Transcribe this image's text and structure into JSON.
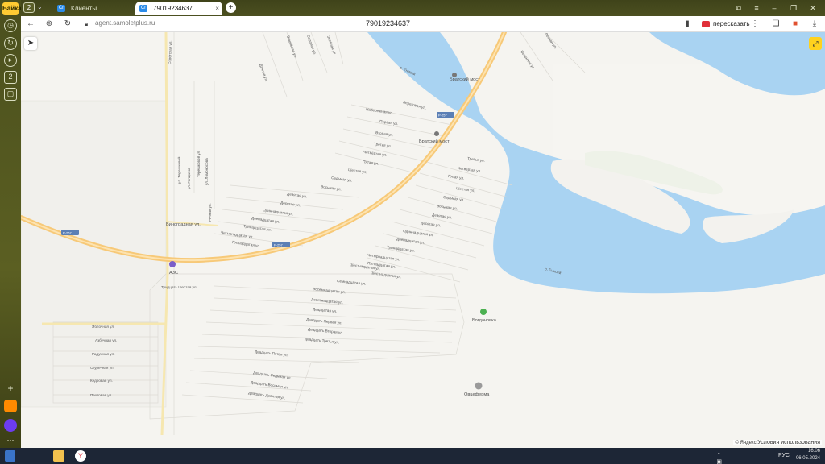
{
  "sidebar": {
    "logo_text": "Байка",
    "counter": "2"
  },
  "tabs": [
    {
      "label": "Клиенты",
      "icon": "Cr"
    },
    {
      "label": "79019234637",
      "icon": "Cr"
    }
  ],
  "tab_counter": "2",
  "address_bar": {
    "url": "agent.samoletplus.ru",
    "title": "79019234637",
    "translate_label": "пересказать"
  },
  "map": {
    "streets": [
      "Советская ул.",
      "ул. Терешковой",
      "Терешковой ул.",
      "ул. Гагарина",
      "ул. Ломоносова",
      "Речная ул.",
      "Виноградная ул.",
      "Яблочная ул.",
      "Азбучная ул.",
      "Радужная ул.",
      "Огуречная ул.",
      "Кедровая ул.",
      "Пахтовая ул.",
      "Набережная ул.",
      "Первая ул.",
      "Вторая ул.",
      "Третья ул.",
      "Четвёртая ул.",
      "Пятая ул.",
      "Шестая ул.",
      "Седьмая ул.",
      "Восьмая ул.",
      "Девятая ул.",
      "Десятая ул.",
      "Одиннадцатая ул.",
      "Двенадцатая ул.",
      "Тринадцатая ул.",
      "Четырнадцатая ул.",
      "Пятнадцатая ул.",
      "Шестнадцатая ул.",
      "Семнадцатая ул.",
      "Восемнадцатая ул.",
      "Девятнадцатая ул.",
      "Двадцатая ул.",
      "Двадцать Первая ул.",
      "Двадцать Вторая ул.",
      "Двадцать Третья ул.",
      "Двадцать Пятая ул.",
      "Двадцать Седьмая ул.",
      "Двадцать Восьмая ул.",
      "Двадцать Девятая ул.",
      "Тридцать Шестая ул.",
      "Дачная ул.",
      "Вишнёвая ул.",
      "Садовая ул.",
      "Зелёная ул.",
      "Лесная ул.",
      "Весенняя ул.",
      "Береговая ул."
    ],
    "right_streets": [
      "Третья ул.",
      "Четвёртая ул.",
      "Пятая ул.",
      "Шестая ул.",
      "Седьмая ул.",
      "Восьмая ул.",
      "Девятая ул.",
      "Десятая ул.",
      "Одиннадцатая ул.",
      "Двенадцатая ул.",
      "Тринадцатая ул.",
      "Четырнадцатая ул.",
      "Пятнадцатая ул.",
      "Шестнадцатая ул."
    ],
    "bridge_top": "Братский мост",
    "bridge_mid": "Братский мост",
    "road_shield_1": "Р-257",
    "road_shield_2": "Р-257",
    "road_shield_3": "Р-257",
    "river_label_1": "р. Енисей",
    "river_label_2": "р. Енисей",
    "gas_station": "АЗС",
    "village": "Богдановка",
    "farm": "Овцеферма",
    "attribution": "© Яндекс",
    "terms": "Условия использования"
  },
  "taskbar": {
    "lang": "РУС",
    "time": "16:06",
    "date": "06.05.2024"
  },
  "colors": {
    "water": "#a9d3f2",
    "road": "#f7c978",
    "sidebar": "#4d511f",
    "taskbar": "#1d2636"
  }
}
